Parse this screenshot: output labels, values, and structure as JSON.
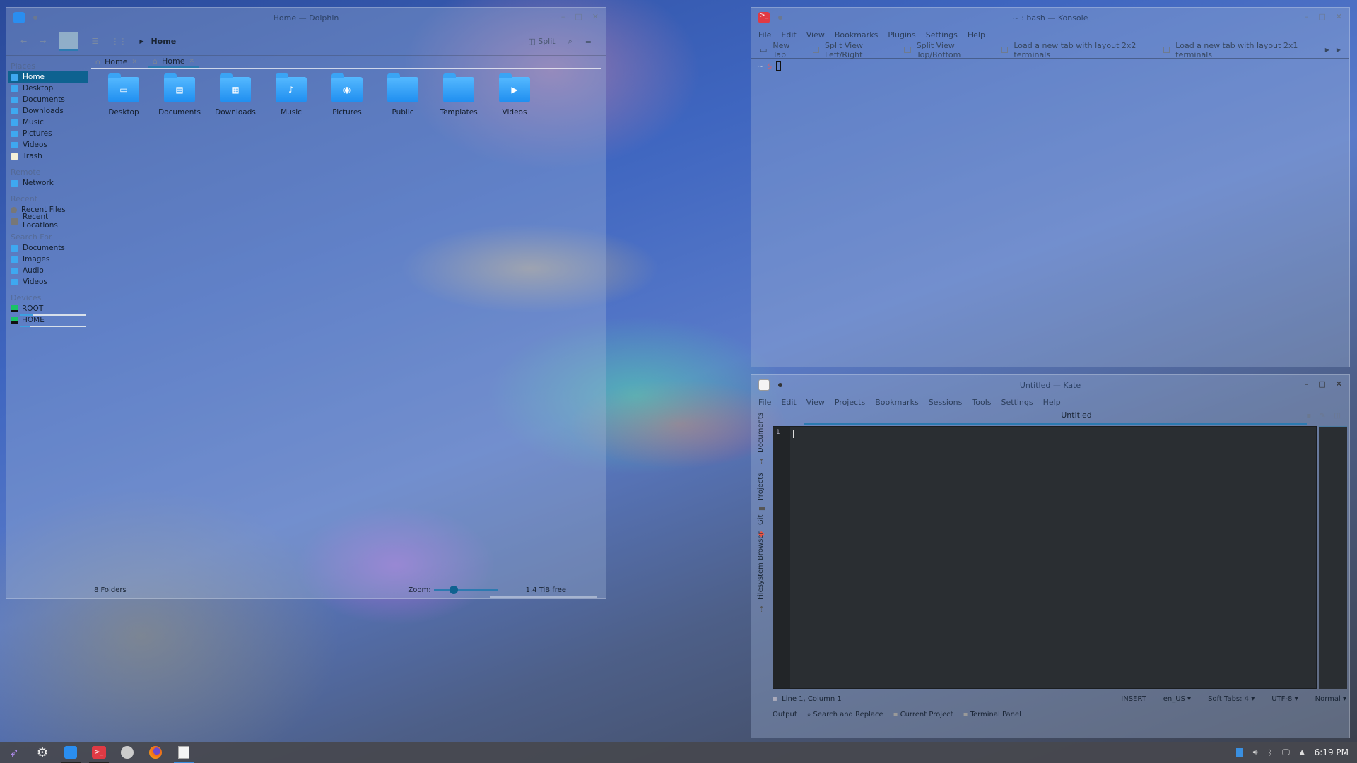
{
  "dolphin": {
    "title": "Home — Dolphin",
    "toolbar": {
      "breadcrumb": "Home",
      "split_label": "Split"
    },
    "window_buttons": [
      "minimize",
      "maximize",
      "close"
    ],
    "places": {
      "sections": {
        "places": "Places",
        "remote": "Remote",
        "recent": "Recent",
        "search": "Search For",
        "devices": "Devices"
      },
      "places_items": [
        {
          "label": "Home",
          "icon": "home-folder-icon",
          "active": true
        },
        {
          "label": "Desktop",
          "icon": "desktop-folder-icon"
        },
        {
          "label": "Documents",
          "icon": "documents-folder-icon"
        },
        {
          "label": "Downloads",
          "icon": "downloads-folder-icon"
        },
        {
          "label": "Music",
          "icon": "music-folder-icon"
        },
        {
          "label": "Pictures",
          "icon": "pictures-folder-icon"
        },
        {
          "label": "Videos",
          "icon": "videos-folder-icon"
        },
        {
          "label": "Trash",
          "icon": "trash-icon"
        }
      ],
      "remote_items": [
        {
          "label": "Network",
          "icon": "network-folder-icon"
        }
      ],
      "recent_items": [
        {
          "label": "Recent Files",
          "icon": "recent-files-icon"
        },
        {
          "label": "Recent Locations",
          "icon": "recent-locations-icon"
        }
      ],
      "search_items": [
        {
          "label": "Documents",
          "icon": "documents-search-icon"
        },
        {
          "label": "Images",
          "icon": "images-search-icon"
        },
        {
          "label": "Audio",
          "icon": "audio-search-icon"
        },
        {
          "label": "Videos",
          "icon": "videos-search-icon"
        }
      ],
      "devices": [
        {
          "label": "ROOT",
          "usage_fraction": 0.18
        },
        {
          "label": "HOME",
          "usage_fraction": 0.15
        }
      ]
    },
    "tabs": [
      {
        "label": "Home",
        "active": false
      },
      {
        "label": "Home",
        "active": true
      }
    ],
    "folders": [
      {
        "label": "Desktop",
        "glyph": "▭"
      },
      {
        "label": "Documents",
        "glyph": "▤"
      },
      {
        "label": "Downloads",
        "glyph": "▦"
      },
      {
        "label": "Music",
        "glyph": "♪"
      },
      {
        "label": "Pictures",
        "glyph": "◉"
      },
      {
        "label": "Public",
        "glyph": ""
      },
      {
        "label": "Templates",
        "glyph": ""
      },
      {
        "label": "Videos",
        "glyph": "▶"
      }
    ],
    "status": {
      "count": "8 Folders",
      "zoom_label": "Zoom:",
      "zoom_fraction": 0.25,
      "free_space": "1.4 TiB free"
    }
  },
  "konsole": {
    "title": "~ : bash — Konsole",
    "menu": [
      "File",
      "Edit",
      "View",
      "Bookmarks",
      "Plugins",
      "Settings",
      "Help"
    ],
    "toolbar": [
      "New Tab",
      "Split View Left/Right",
      "Split View Top/Bottom",
      "Load a new tab with layout 2x2 terminals",
      "Load a new tab with layout 2x1 terminals"
    ],
    "prompt": {
      "dir": "~",
      "symbol": "$"
    }
  },
  "kate": {
    "title": "Untitled — Kate",
    "menu": [
      "File",
      "Edit",
      "View",
      "Projects",
      "Bookmarks",
      "Sessions",
      "Tools",
      "Settings",
      "Help"
    ],
    "tab": "Untitled",
    "side_tabs": [
      "Documents",
      "Projects",
      "Git",
      "Filesystem Browser"
    ],
    "line_number": "1",
    "status": {
      "position": "Line 1, Column 1",
      "mode": "INSERT",
      "language": "en_US",
      "indent": "Soft Tabs: 4",
      "encoding": "UTF-8",
      "input_mode": "Normal"
    },
    "bottom_panels": [
      "Output",
      "Search and Replace",
      "Current Project",
      "Terminal Panel"
    ]
  },
  "taskbar": {
    "apps": [
      {
        "name": "launcher",
        "icon": "rocket-icon"
      },
      {
        "name": "system-settings",
        "icon": "gear-icon"
      },
      {
        "name": "dolphin",
        "icon": "dolphin-icon",
        "open": true
      },
      {
        "name": "konsole",
        "icon": "konsole-icon",
        "open": true
      },
      {
        "name": "steam",
        "icon": "steam-icon"
      },
      {
        "name": "firefox",
        "icon": "firefox-icon"
      },
      {
        "name": "kate",
        "icon": "kate-icon",
        "open": true,
        "active": true
      }
    ],
    "clock": "6:19 PM"
  }
}
